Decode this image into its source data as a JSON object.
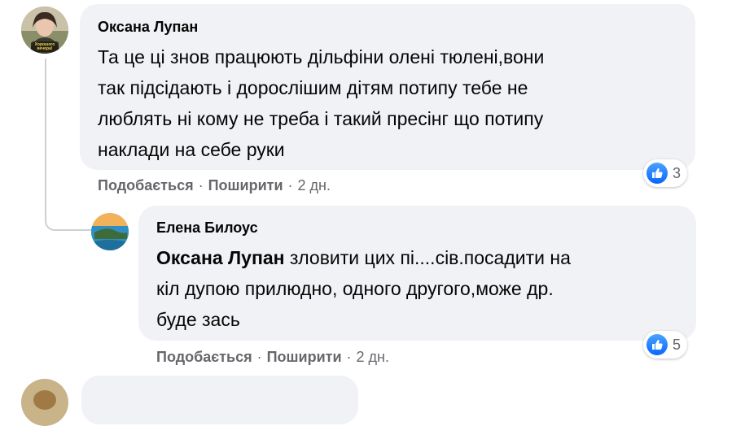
{
  "comments": [
    {
      "author": "Оксана Лупан",
      "avatar_text": "Хорошого вечора!",
      "lines": [
        "Та це ці знов працюють дільфіни олені тюлені,вони",
        "так підсідають і дорослішим дітям потипу тебе не",
        "люблять ні кому не треба і такий пресінг що потипу",
        "наклади на себе руки"
      ],
      "actions": {
        "like": "Подобається",
        "share": "Поширити",
        "time": "2 дн.",
        "sep": "·"
      },
      "reaction_count": "3"
    },
    {
      "author": "Елена Билоус",
      "mention": "Оксана Лупан",
      "lines": [
        " зловити цих пі....сів.посадити на",
        "кіл дупою прилюдно, одного другого,може др.",
        "буде зась"
      ],
      "actions": {
        "like": "Подобається",
        "share": "Поширити",
        "time": "2 дн.",
        "sep": "·"
      },
      "reaction_count": "5"
    }
  ],
  "colors": {
    "bubble": "#f0f2f5",
    "meta": "#65676b",
    "like_blue": "#0866ff",
    "thread_line": "#ced0d4"
  },
  "icons": {
    "reaction": "like-thumb-icon"
  }
}
